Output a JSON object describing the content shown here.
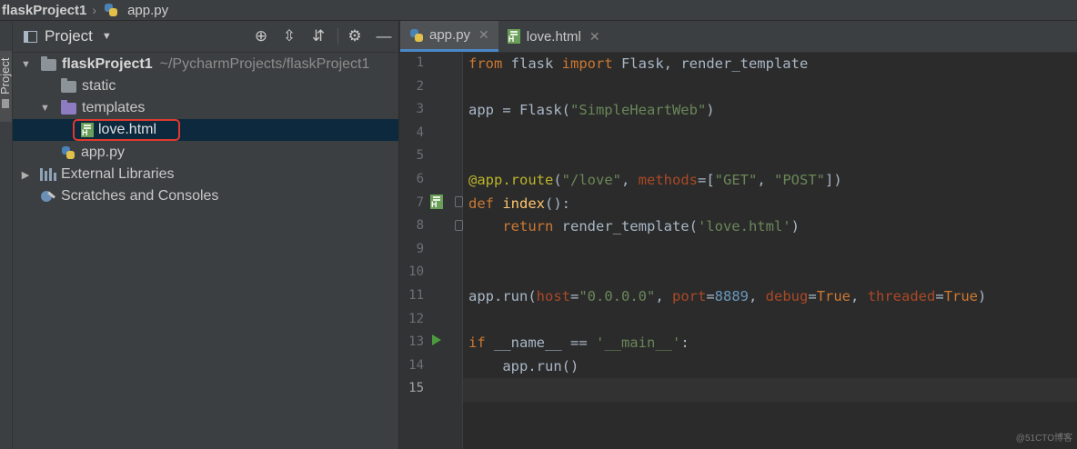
{
  "breadcrumb": {
    "project": "flaskProject1",
    "file": "app.py"
  },
  "left_strip": {
    "label": "Project"
  },
  "project_panel": {
    "title": "Project",
    "tree": [
      {
        "label": "flaskProject1",
        "path": "~/PycharmProjects/flaskProject1",
        "type": "folder",
        "expanded": true
      },
      {
        "label": "static",
        "type": "folder"
      },
      {
        "label": "templates",
        "type": "folder",
        "expanded": true
      },
      {
        "label": "love.html",
        "type": "html",
        "selected": true
      },
      {
        "label": "app.py",
        "type": "python"
      },
      {
        "label": "External Libraries",
        "type": "libraries"
      },
      {
        "label": "Scratches and Consoles",
        "type": "scratches"
      }
    ]
  },
  "editor": {
    "tabs": [
      {
        "label": "app.py",
        "active": true
      },
      {
        "label": "love.html",
        "active": false
      }
    ],
    "line_numbers": [
      "1",
      "2",
      "3",
      "4",
      "5",
      "6",
      "7",
      "8",
      "9",
      "10",
      "11",
      "12",
      "13",
      "14",
      "15"
    ],
    "current_line": 15,
    "code": [
      [
        {
          "t": "kw",
          "v": "from "
        },
        {
          "t": "plain",
          "v": "flask "
        },
        {
          "t": "kw",
          "v": "import "
        },
        {
          "t": "plain",
          "v": "Flask, render_template"
        }
      ],
      [],
      [
        {
          "t": "plain",
          "v": "app = Flask("
        },
        {
          "t": "str",
          "v": "\"SimpleHeartWeb\""
        },
        {
          "t": "plain",
          "v": ")"
        }
      ],
      [],
      [],
      [
        {
          "t": "dec",
          "v": "@app.route"
        },
        {
          "t": "plain",
          "v": "("
        },
        {
          "t": "str",
          "v": "\"/love\""
        },
        {
          "t": "plain",
          "v": ", "
        },
        {
          "t": "param",
          "v": "methods"
        },
        {
          "t": "plain",
          "v": "=["
        },
        {
          "t": "str",
          "v": "\"GET\""
        },
        {
          "t": "plain",
          "v": ", "
        },
        {
          "t": "str",
          "v": "\"POST\""
        },
        {
          "t": "plain",
          "v": "])"
        }
      ],
      [
        {
          "t": "kw",
          "v": "def "
        },
        {
          "t": "fn",
          "v": "index"
        },
        {
          "t": "plain",
          "v": "():"
        }
      ],
      [
        {
          "t": "plain",
          "v": "    "
        },
        {
          "t": "kw",
          "v": "return "
        },
        {
          "t": "plain",
          "v": "render_template("
        },
        {
          "t": "str",
          "v": "'love.html'"
        },
        {
          "t": "plain",
          "v": ")"
        }
      ],
      [],
      [],
      [
        {
          "t": "plain",
          "v": "app.run("
        },
        {
          "t": "param",
          "v": "host"
        },
        {
          "t": "plain",
          "v": "="
        },
        {
          "t": "str",
          "v": "\"0.0.0.0\""
        },
        {
          "t": "plain",
          "v": ", "
        },
        {
          "t": "param",
          "v": "port"
        },
        {
          "t": "plain",
          "v": "="
        },
        {
          "t": "num",
          "v": "8889"
        },
        {
          "t": "plain",
          "v": ", "
        },
        {
          "t": "param",
          "v": "debug"
        },
        {
          "t": "plain",
          "v": "="
        },
        {
          "t": "kw",
          "v": "True"
        },
        {
          "t": "plain",
          "v": ", "
        },
        {
          "t": "param",
          "v": "threaded"
        },
        {
          "t": "plain",
          "v": "="
        },
        {
          "t": "kw",
          "v": "True"
        },
        {
          "t": "plain",
          "v": ")"
        }
      ],
      [],
      [
        {
          "t": "kw",
          "v": "if "
        },
        {
          "t": "plain",
          "v": "__name__ == "
        },
        {
          "t": "str",
          "v": "'__main__'"
        },
        {
          "t": "plain",
          "v": ":"
        }
      ],
      [
        {
          "t": "plain",
          "v": "    app.run()"
        }
      ],
      []
    ]
  },
  "watermark": "@51CTO博客",
  "colors": {
    "accent": "#4a88c7",
    "highlight_box": "#e03a2f",
    "selection": "#0d293e"
  }
}
